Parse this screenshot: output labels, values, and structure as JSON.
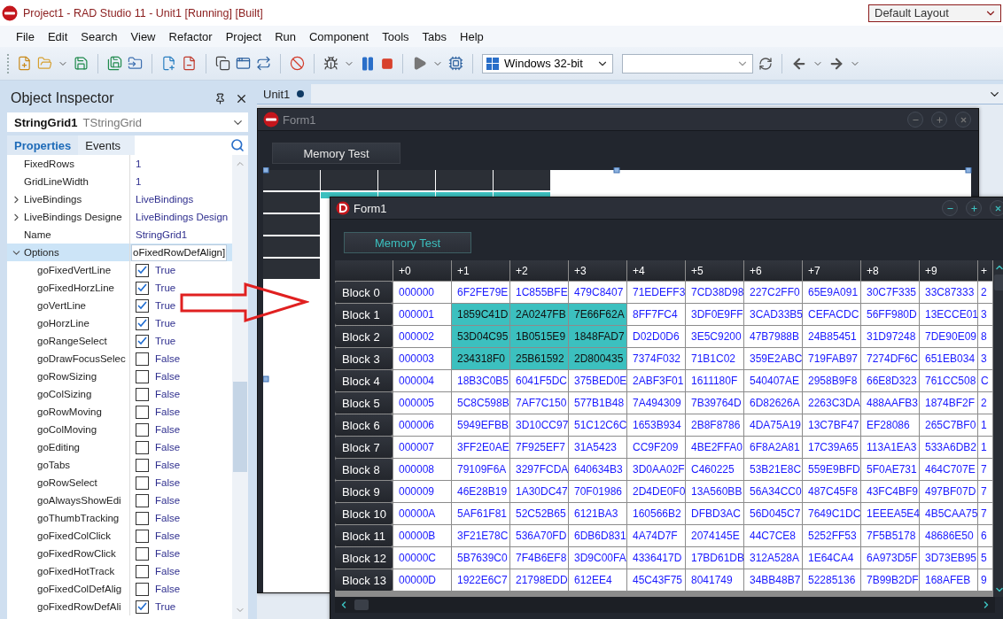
{
  "window": {
    "title": "Project1 - RAD Studio 11 - Unit1 [Running] [Built]",
    "layout_selector": "Default Layout"
  },
  "menu": [
    "File",
    "Edit",
    "Search",
    "View",
    "Refactor",
    "Project",
    "Run",
    "Component",
    "Tools",
    "Tabs",
    "Help"
  ],
  "toolbar": {
    "platform": "Windows 32-bit"
  },
  "object_inspector": {
    "title": "Object Inspector",
    "component": {
      "name": "StringGrid1",
      "type": "TStringGrid"
    },
    "tabs": [
      {
        "label": "Properties",
        "selected": true
      },
      {
        "label": "Events",
        "selected": false
      }
    ],
    "properties": [
      {
        "name": "FixedRows",
        "value": "1",
        "kind": "text",
        "selected": false
      },
      {
        "name": "GridLineWidth",
        "value": "1",
        "kind": "text",
        "selected": false
      },
      {
        "name": "LiveBindings",
        "value": "LiveBindings",
        "kind": "text",
        "expanded": false,
        "selected": false
      },
      {
        "name": "LiveBindings Designe",
        "value": "LiveBindings Design",
        "kind": "text",
        "expanded": false,
        "selected": false
      },
      {
        "name": "Name",
        "value": "StringGrid1",
        "kind": "text",
        "selected": false
      },
      {
        "name": "Options",
        "value": "oFixedRowDefAlign]",
        "kind": "edit",
        "expanded": true,
        "selected": true,
        "children": [
          {
            "name": "goFixedVertLine",
            "value": "True",
            "kind": "checkbox",
            "checked": true,
            "selected": false
          },
          {
            "name": "goFixedHorzLine",
            "value": "True",
            "kind": "checkbox",
            "checked": true,
            "selected": false
          },
          {
            "name": "goVertLine",
            "value": "True",
            "kind": "checkbox",
            "checked": true,
            "selected": false
          },
          {
            "name": "goHorzLine",
            "value": "True",
            "kind": "checkbox",
            "checked": true,
            "selected": false
          },
          {
            "name": "goRangeSelect",
            "value": "True",
            "kind": "checkbox",
            "checked": true,
            "selected": false
          },
          {
            "name": "goDrawFocusSelec",
            "value": "False",
            "kind": "checkbox",
            "checked": false,
            "selected": false
          },
          {
            "name": "goRowSizing",
            "value": "False",
            "kind": "checkbox",
            "checked": false,
            "selected": false
          },
          {
            "name": "goColSizing",
            "value": "False",
            "kind": "checkbox",
            "checked": false,
            "selected": false
          },
          {
            "name": "goRowMoving",
            "value": "False",
            "kind": "checkbox",
            "checked": false,
            "selected": false
          },
          {
            "name": "goColMoving",
            "value": "False",
            "kind": "checkbox",
            "checked": false,
            "selected": false
          },
          {
            "name": "goEditing",
            "value": "False",
            "kind": "checkbox",
            "checked": false,
            "selected": false
          },
          {
            "name": "goTabs",
            "value": "False",
            "kind": "checkbox",
            "checked": false,
            "selected": false
          },
          {
            "name": "goRowSelect",
            "value": "False",
            "kind": "checkbox",
            "checked": false,
            "selected": false
          },
          {
            "name": "goAlwaysShowEdi",
            "value": "False",
            "kind": "checkbox",
            "checked": false,
            "selected": false
          },
          {
            "name": "goThumbTracking",
            "value": "False",
            "kind": "checkbox",
            "checked": false,
            "selected": false
          },
          {
            "name": "goFixedColClick",
            "value": "False",
            "kind": "checkbox",
            "checked": false,
            "selected": false
          },
          {
            "name": "goFixedRowClick",
            "value": "False",
            "kind": "checkbox",
            "checked": false,
            "selected": false
          },
          {
            "name": "goFixedHotTrack",
            "value": "False",
            "kind": "checkbox",
            "checked": false,
            "selected": false
          },
          {
            "name": "goFixedColDefAlig",
            "value": "False",
            "kind": "checkbox",
            "checked": false,
            "selected": false
          },
          {
            "name": "goFixedRowDefAli",
            "value": "True",
            "kind": "checkbox",
            "checked": true,
            "selected": false
          }
        ]
      }
    ]
  },
  "editor_tabs": [
    {
      "label": "Unit1",
      "modified": true,
      "selected": true
    }
  ],
  "designer_form": {
    "title": "Form1",
    "active": false,
    "button": "Memory Test"
  },
  "running_form": {
    "title": "Form1",
    "active": true,
    "button": "Memory Test",
    "grid": {
      "columns": [
        "+0",
        "+1",
        "+2",
        "+3",
        "+4",
        "+5",
        "+6",
        "+7",
        "+8",
        "+9",
        "+"
      ],
      "rows": [
        {
          "header": "Block 0",
          "cells": [
            {
              "value": "000000",
              "selected": false
            },
            {
              "value": "6F2FE79E",
              "selected": false
            },
            {
              "value": "1C855BFE",
              "selected": false
            },
            {
              "value": "479C8407",
              "selected": false
            },
            {
              "value": "71EDEFF3",
              "selected": false
            },
            {
              "value": "7CD38D98",
              "selected": false
            },
            {
              "value": "227C2FF0",
              "selected": false
            },
            {
              "value": "65E9A091",
              "selected": false
            },
            {
              "value": "30C7F335",
              "selected": false
            },
            {
              "value": "33C87333",
              "selected": false
            },
            {
              "value": "2",
              "selected": false
            }
          ]
        },
        {
          "header": "Block 1",
          "cells": [
            {
              "value": "000001",
              "selected": false
            },
            {
              "value": "1859C41D",
              "selected": true
            },
            {
              "value": "2A0247FB",
              "selected": true
            },
            {
              "value": "7E66F62A",
              "selected": true
            },
            {
              "value": "8FF7FC4",
              "selected": false
            },
            {
              "value": "3DF0E9FF",
              "selected": false
            },
            {
              "value": "3CAD33B5",
              "selected": false
            },
            {
              "value": "CEFACDC",
              "selected": false
            },
            {
              "value": "56FF980D",
              "selected": false
            },
            {
              "value": "13ECCE01",
              "selected": false
            },
            {
              "value": "3",
              "selected": false
            }
          ]
        },
        {
          "header": "Block 2",
          "cells": [
            {
              "value": "000002",
              "selected": false
            },
            {
              "value": "53D04C95",
              "selected": true
            },
            {
              "value": "1B0515E9",
              "selected": true
            },
            {
              "value": "1848FAD7",
              "selected": true
            },
            {
              "value": "D02D0D6",
              "selected": false
            },
            {
              "value": "3E5C9200",
              "selected": false
            },
            {
              "value": "47B7988B",
              "selected": false
            },
            {
              "value": "24B85451",
              "selected": false
            },
            {
              "value": "31D97248",
              "selected": false
            },
            {
              "value": "7DE90E09",
              "selected": false
            },
            {
              "value": "8",
              "selected": false
            }
          ]
        },
        {
          "header": "Block 3",
          "cells": [
            {
              "value": "000003",
              "selected": false
            },
            {
              "value": "234318F0",
              "selected": true
            },
            {
              "value": "25B61592",
              "selected": true
            },
            {
              "value": "2D800435",
              "selected": true
            },
            {
              "value": "7374F032",
              "selected": false
            },
            {
              "value": "71B1C02",
              "selected": false
            },
            {
              "value": "359E2ABC",
              "selected": false
            },
            {
              "value": "719FAB97",
              "selected": false
            },
            {
              "value": "7274DF6C",
              "selected": false
            },
            {
              "value": "651EB034",
              "selected": false
            },
            {
              "value": "3",
              "selected": false
            }
          ]
        },
        {
          "header": "Block 4",
          "cells": [
            {
              "value": "000004",
              "selected": false
            },
            {
              "value": "18B3C0B5",
              "selected": false
            },
            {
              "value": "6041F5DC",
              "selected": false
            },
            {
              "value": "375BED0E",
              "selected": false
            },
            {
              "value": "2ABF3F01",
              "selected": false
            },
            {
              "value": "1611180F",
              "selected": false
            },
            {
              "value": "540407AE",
              "selected": false
            },
            {
              "value": "2958B9F8",
              "selected": false
            },
            {
              "value": "66E8D323",
              "selected": false
            },
            {
              "value": "761CC508",
              "selected": false
            },
            {
              "value": "C",
              "selected": false
            }
          ]
        },
        {
          "header": "Block 5",
          "cells": [
            {
              "value": "000005",
              "selected": false
            },
            {
              "value": "5C8C598B",
              "selected": false
            },
            {
              "value": "7AF7C150",
              "selected": false
            },
            {
              "value": "577B1B48",
              "selected": false
            },
            {
              "value": "7A494309",
              "selected": false
            },
            {
              "value": "7B39764D",
              "selected": false
            },
            {
              "value": "6D82626A",
              "selected": false
            },
            {
              "value": "2263C3DA",
              "selected": false
            },
            {
              "value": "488AAFB3",
              "selected": false
            },
            {
              "value": "1874BF2F",
              "selected": false
            },
            {
              "value": "2",
              "selected": false
            }
          ]
        },
        {
          "header": "Block 6",
          "cells": [
            {
              "value": "000006",
              "selected": false
            },
            {
              "value": "5949EFBB",
              "selected": false
            },
            {
              "value": "3D10CC97",
              "selected": false
            },
            {
              "value": "51C12C6C",
              "selected": false
            },
            {
              "value": "1653B934",
              "selected": false
            },
            {
              "value": "2B8F8786",
              "selected": false
            },
            {
              "value": "4DA75A19",
              "selected": false
            },
            {
              "value": "13C7BF47",
              "selected": false
            },
            {
              "value": "EF28086",
              "selected": false
            },
            {
              "value": "265C7BF0",
              "selected": false
            },
            {
              "value": "1",
              "selected": false
            }
          ]
        },
        {
          "header": "Block 7",
          "cells": [
            {
              "value": "000007",
              "selected": false
            },
            {
              "value": "3FF2E0AE",
              "selected": false
            },
            {
              "value": "7F925EF7",
              "selected": false
            },
            {
              "value": "31A5423",
              "selected": false
            },
            {
              "value": "CC9F209",
              "selected": false
            },
            {
              "value": "4BE2FFA0",
              "selected": false
            },
            {
              "value": "6F8A2A81",
              "selected": false
            },
            {
              "value": "17C39A65",
              "selected": false
            },
            {
              "value": "113A1EA3",
              "selected": false
            },
            {
              "value": "533A6DB2",
              "selected": false
            },
            {
              "value": "1",
              "selected": false
            }
          ]
        },
        {
          "header": "Block 8",
          "cells": [
            {
              "value": "000008",
              "selected": false
            },
            {
              "value": "79109F6A",
              "selected": false
            },
            {
              "value": "3297FCDA",
              "selected": false
            },
            {
              "value": "640634B3",
              "selected": false
            },
            {
              "value": "3D0AA02F",
              "selected": false
            },
            {
              "value": "C460225",
              "selected": false
            },
            {
              "value": "53B21E8C",
              "selected": false
            },
            {
              "value": "559E9BFD",
              "selected": false
            },
            {
              "value": "5F0AE731",
              "selected": false
            },
            {
              "value": "464C707E",
              "selected": false
            },
            {
              "value": "7",
              "selected": false
            }
          ]
        },
        {
          "header": "Block 9",
          "cells": [
            {
              "value": "000009",
              "selected": false
            },
            {
              "value": "46E28B19",
              "selected": false
            },
            {
              "value": "1A30DC47",
              "selected": false
            },
            {
              "value": "70F01986",
              "selected": false
            },
            {
              "value": "2D4DE0F0",
              "selected": false
            },
            {
              "value": "13A560BB",
              "selected": false
            },
            {
              "value": "56A34CC0",
              "selected": false
            },
            {
              "value": "487C45F8",
              "selected": false
            },
            {
              "value": "43FC4BF9",
              "selected": false
            },
            {
              "value": "497BF07D",
              "selected": false
            },
            {
              "value": "7",
              "selected": false
            }
          ]
        },
        {
          "header": "Block 10",
          "cells": [
            {
              "value": "00000A",
              "selected": false
            },
            {
              "value": "5AF61F81",
              "selected": false
            },
            {
              "value": "52C52B65",
              "selected": false
            },
            {
              "value": "6121BA3",
              "selected": false
            },
            {
              "value": "160566B2",
              "selected": false
            },
            {
              "value": "DFBD3AC",
              "selected": false
            },
            {
              "value": "56D045C7",
              "selected": false
            },
            {
              "value": "7649C1DC",
              "selected": false
            },
            {
              "value": "1EEEA5E4",
              "selected": false
            },
            {
              "value": "4B5CAA75",
              "selected": false
            },
            {
              "value": "7",
              "selected": false
            }
          ]
        },
        {
          "header": "Block 11",
          "cells": [
            {
              "value": "00000B",
              "selected": false
            },
            {
              "value": "3F21E78C",
              "selected": false
            },
            {
              "value": "536A70FD",
              "selected": false
            },
            {
              "value": "6DB6D831",
              "selected": false
            },
            {
              "value": "4A74D7F",
              "selected": false
            },
            {
              "value": "2074145E",
              "selected": false
            },
            {
              "value": "44C7CE8",
              "selected": false
            },
            {
              "value": "5252FF53",
              "selected": false
            },
            {
              "value": "7F5B5178",
              "selected": false
            },
            {
              "value": "48686E50",
              "selected": false
            },
            {
              "value": "6",
              "selected": false
            }
          ]
        },
        {
          "header": "Block 12",
          "cells": [
            {
              "value": "00000C",
              "selected": false
            },
            {
              "value": "5B7639C0",
              "selected": false
            },
            {
              "value": "7F4B6EF8",
              "selected": false
            },
            {
              "value": "3D9C00FA",
              "selected": false
            },
            {
              "value": "4336417D",
              "selected": false
            },
            {
              "value": "17BD61DB",
              "selected": false
            },
            {
              "value": "312A528A",
              "selected": false
            },
            {
              "value": "1E64CA4",
              "selected": false
            },
            {
              "value": "6A973D5F",
              "selected": false
            },
            {
              "value": "3D73EB95",
              "selected": false
            },
            {
              "value": "5",
              "selected": false
            }
          ]
        },
        {
          "header": "Block 13",
          "cells": [
            {
              "value": "00000D",
              "selected": false
            },
            {
              "value": "1922E6C7",
              "selected": false
            },
            {
              "value": "21798EDD",
              "selected": false
            },
            {
              "value": "612EE4",
              "selected": false
            },
            {
              "value": "45C43F75",
              "selected": false
            },
            {
              "value": "8041749",
              "selected": false
            },
            {
              "value": "34BB48B7",
              "selected": false
            },
            {
              "value": "52285136",
              "selected": false
            },
            {
              "value": "7B99B2DF",
              "selected": false
            },
            {
              "value": "168AFEB",
              "selected": false
            },
            {
              "value": "9",
              "selected": false
            }
          ]
        }
      ]
    }
  }
}
